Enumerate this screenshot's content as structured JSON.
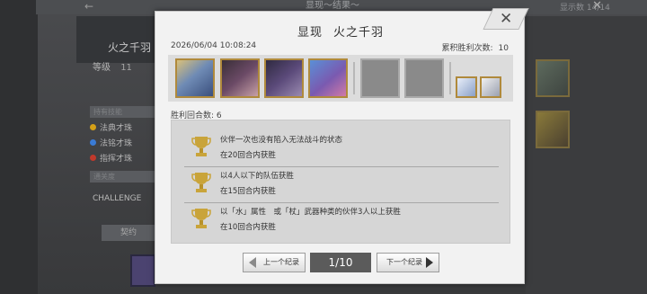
{
  "background": {
    "crumb": "显现～结果～",
    "page_count": "显示数 14/14",
    "character_name": "火之千羽",
    "level_label": "等级",
    "level_value": "11",
    "side_header": "持有技能",
    "skills": [
      {
        "label": "法典才珠",
        "color": "#d4a017"
      },
      {
        "label": "法铭才珠",
        "color": "#3a7bd5"
      },
      {
        "label": "指挥才珠",
        "color": "#c0392b"
      }
    ],
    "challenge_header": "通关度",
    "challenge_label": "CHALLENGE",
    "bottom_button": "契约"
  },
  "modal": {
    "title_prefix": "显现",
    "title_name": "火之千羽",
    "close_label": "✕",
    "timestamp": "2026/06/04 10:08:24",
    "wins_label": "累积胜利次数:",
    "wins_value": "10",
    "rounds_label": "胜利回合数: 6",
    "party_icons": [
      "character-portrait-1",
      "character-portrait-2",
      "character-portrait-3",
      "character-portrait-4",
      "empty-slot",
      "empty-slot",
      "support-icon-1",
      "support-icon-2"
    ],
    "achievements": [
      {
        "title": "伙伴一次也没有陷入无法战斗的状态",
        "detail": "在20回合内获胜",
        "icon": "trophy-icon"
      },
      {
        "title": "以4人以下的队伍获胜",
        "detail": "在15回合内获胜",
        "icon": "trophy-icon"
      },
      {
        "title": "以「水」属性　或「杖」武器种类的伙伴3人以上获胜",
        "detail": "在10回合内获胜",
        "icon": "trophy-icon"
      }
    ],
    "prev_label": "上一个纪录",
    "next_label": "下一个纪录",
    "pager": "1/10",
    "colors": {
      "accent_gold": "#b08a3c",
      "trophy": "#c9a43a",
      "pager_bg": "#5b5b5b"
    }
  }
}
